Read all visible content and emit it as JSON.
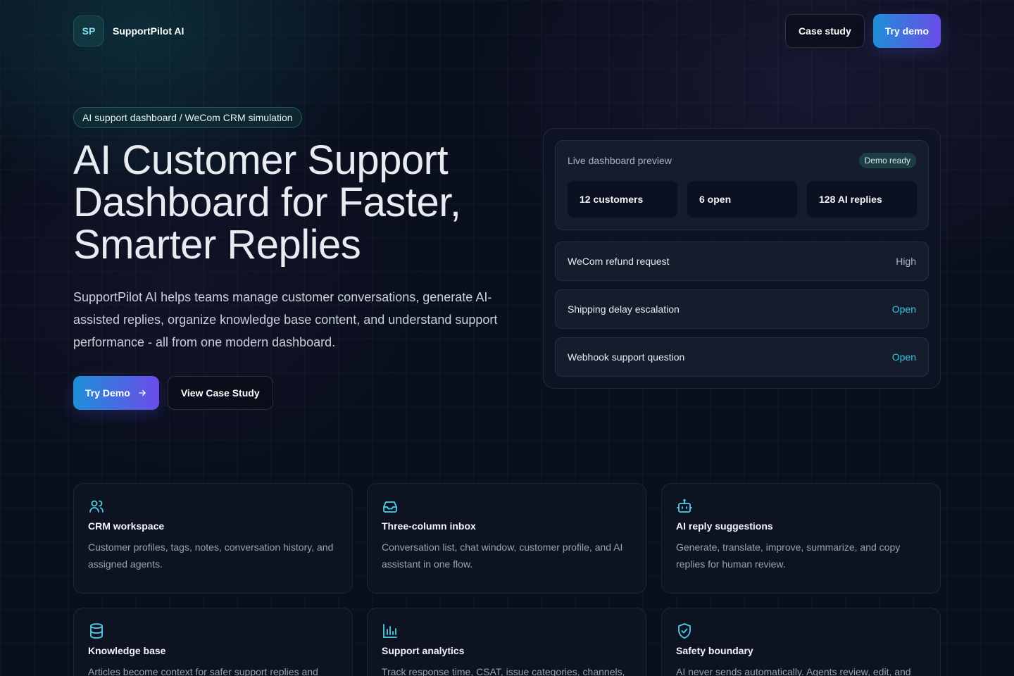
{
  "header": {
    "logo_text": "SP",
    "brand_name": "SupportPilot AI",
    "case_study_label": "Case study",
    "try_demo_label": "Try demo"
  },
  "hero": {
    "pill": "AI support dashboard / WeCom CRM simulation",
    "title": "AI Customer Support Dashboard for Faster, Smarter Replies",
    "subtitle": "SupportPilot AI helps teams manage customer conversations, generate AI-assisted replies, organize knowledge base content, and understand support performance - all from one modern dashboard.",
    "cta_primary": "Try Demo",
    "cta_secondary": "View Case Study"
  },
  "preview": {
    "label": "Live dashboard preview",
    "badge": "Demo ready",
    "stats": [
      "12 customers",
      "6 open",
      "128 AI replies"
    ],
    "tickets": [
      {
        "title": "WeCom refund request",
        "status": "High"
      },
      {
        "title": "Shipping delay escalation",
        "status": "Open"
      },
      {
        "title": "Webhook support question",
        "status": "Open"
      }
    ]
  },
  "features": [
    {
      "icon": "users-icon",
      "title": "CRM workspace",
      "desc": "Customer profiles, tags, notes, conversation history, and assigned agents."
    },
    {
      "icon": "inbox-icon",
      "title": "Three-column inbox",
      "desc": "Conversation list, chat window, customer profile, and AI assistant in one flow."
    },
    {
      "icon": "bot-icon",
      "title": "AI reply suggestions",
      "desc": "Generate, translate, improve, summarize, and copy replies for human review."
    },
    {
      "icon": "database-icon",
      "title": "Knowledge base",
      "desc": "Articles become context for safer support replies and"
    },
    {
      "icon": "bar-chart-icon",
      "title": "Support analytics",
      "desc": "Track response time, CSAT, issue categories, channels,"
    },
    {
      "icon": "shield-check-icon",
      "title": "Safety boundary",
      "desc": "AI never sends automatically. Agents review, edit, and"
    }
  ],
  "colors": {
    "accent": "#38c8e0",
    "gradient_start": "#1f8fd8",
    "gradient_end": "#6b4ce8",
    "background": "#0a0f1d"
  }
}
